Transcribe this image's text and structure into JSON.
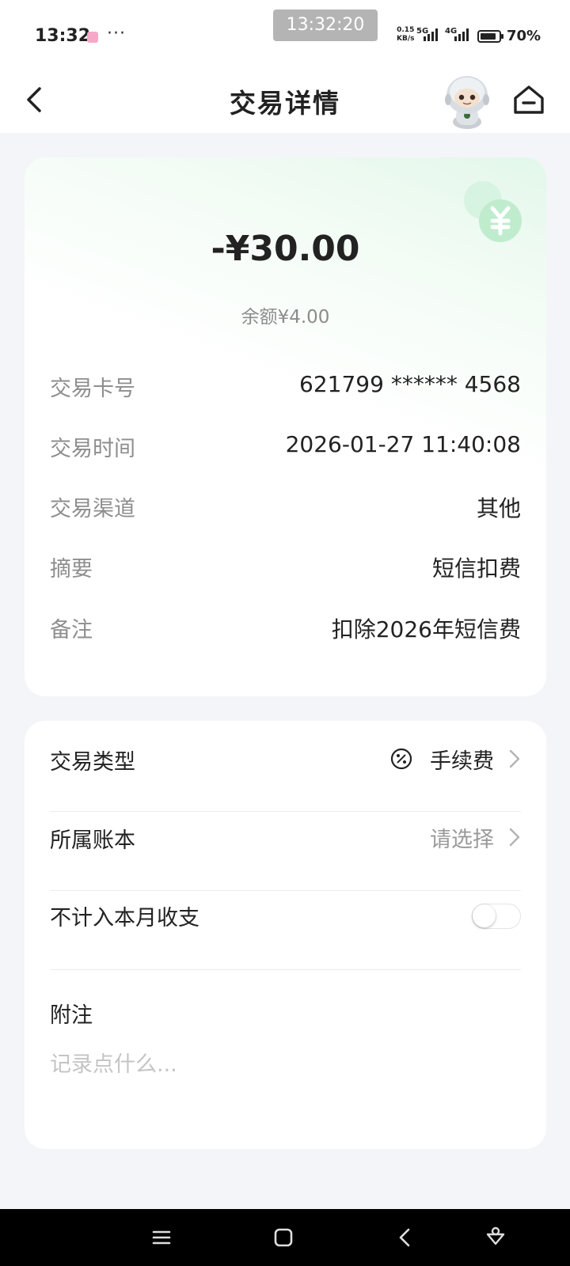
{
  "status_bar": {
    "time": "13:32",
    "clock_overlay": "13:32:20",
    "network_speed": "0.15",
    "network_unit": "KB/s",
    "net1": "5G",
    "net2": "4G",
    "battery": "70%"
  },
  "header": {
    "title": "交易详情",
    "back_icon": "chevron-left-icon",
    "assistant_icon": "robot-avatar",
    "home_icon": "home-icon"
  },
  "summary": {
    "amount": "-¥30.00",
    "balance": "余额¥4.00",
    "accent_color": "#7fd9a0",
    "rows": [
      {
        "label": "交易卡号",
        "value": "621799 ****** 4568"
      },
      {
        "label": "交易时间",
        "value": "2026-01-27 11:40:08"
      },
      {
        "label": "交易渠道",
        "value": "其他"
      },
      {
        "label": "摘要",
        "value": "短信扣费"
      },
      {
        "label": "备注",
        "value": "扣除2026年短信费"
      }
    ]
  },
  "options": {
    "type": {
      "label": "交易类型",
      "value": "手续费",
      "icon": "percent-icon"
    },
    "ledger": {
      "label": "所属账本",
      "value": "请选择"
    },
    "exclude": {
      "label": "不计入本月收支",
      "enabled": false
    },
    "note": {
      "label": "附注",
      "placeholder": "记录点什么..."
    }
  },
  "nav": {
    "menu": "menu-icon",
    "home": "home-square-icon",
    "back": "back-icon",
    "assist": "assistant-icon"
  }
}
